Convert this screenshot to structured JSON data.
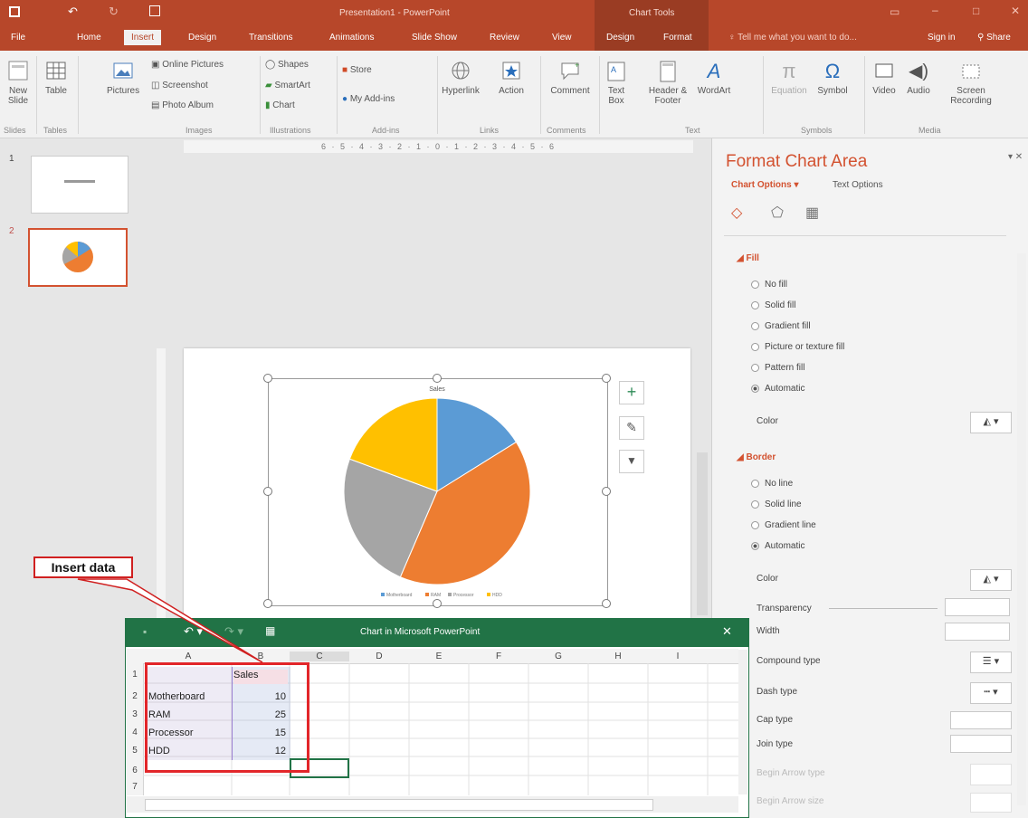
{
  "titlebar": {
    "doc_title": "Presentation1 - PowerPoint",
    "context_tab": "Chart Tools"
  },
  "tabs": [
    "File",
    "Home",
    "Insert",
    "Design",
    "Transitions",
    "Animations",
    "Slide Show",
    "Review",
    "View",
    "Design",
    "Format"
  ],
  "tell_me": "Tell me what you want to do...",
  "sign_in": "Sign in",
  "share": "Share",
  "ribbon": {
    "new_slide": "New Slide",
    "table": "Table",
    "pictures": "Pictures",
    "online_pictures": "Online Pictures",
    "screenshot": "Screenshot",
    "photo_album": "Photo Album",
    "shapes": "Shapes",
    "smartart": "SmartArt",
    "chart": "Chart",
    "store": "Store",
    "my_addins": "My Add-ins",
    "hyperlink": "Hyperlink",
    "action": "Action",
    "comment": "Comment",
    "text_box": "Text Box",
    "header_footer": "Header & Footer",
    "wordart": "WordArt",
    "equation": "Equation",
    "symbol": "Symbol",
    "video": "Video",
    "audio": "Audio",
    "screen_recording": "Screen Recording",
    "groups": [
      "Slides",
      "Tables",
      "Images",
      "Illustrations",
      "Add-ins",
      "Links",
      "Comments",
      "Text",
      "Symbols",
      "Media"
    ]
  },
  "slides": [
    "1",
    "2"
  ],
  "ruler_text": "6 · 5 · 4 · 3 · 2 · 1 · 0 · 1 · 2 · 3 · 4 · 5 · 6",
  "callout": "Insert data",
  "format_pane": {
    "title": "Format Chart Area",
    "chart_options": "Chart Options",
    "text_options": "Text Options",
    "fill_header": "Fill",
    "fill_options": [
      "No fill",
      "Solid fill",
      "Gradient fill",
      "Picture or texture fill",
      "Pattern fill",
      "Automatic"
    ],
    "color_label": "Color",
    "border_header": "Border",
    "border_options": [
      "No line",
      "Solid line",
      "Gradient line",
      "Automatic"
    ],
    "border_color": "Color",
    "transparency": "Transparency",
    "width": "Width",
    "compound_type": "Compound type",
    "dash_type": "Dash type",
    "cap_type": "Cap type",
    "join_type": "Join type",
    "begin_arrow_type": "Begin Arrow type",
    "begin_arrow_size": "Begin Arrow size"
  },
  "excel": {
    "title": "Chart in Microsoft PowerPoint",
    "columns": [
      "A",
      "B",
      "C",
      "D",
      "E",
      "F",
      "G",
      "H",
      "I"
    ],
    "rows": [
      "1",
      "2",
      "3",
      "4",
      "5",
      "6",
      "7"
    ],
    "header_b": "Sales",
    "data": [
      {
        "name": "Motherboard",
        "value": "10"
      },
      {
        "name": "RAM",
        "value": "25"
      },
      {
        "name": "Processor",
        "value": "15"
      },
      {
        "name": "HDD",
        "value": "12"
      }
    ]
  },
  "chart_data": {
    "type": "pie",
    "title": "Sales",
    "categories": [
      "Motherboard",
      "RAM",
      "Processor",
      "HDD"
    ],
    "values": [
      10,
      25,
      15,
      12
    ],
    "colors": [
      "#5b9bd5",
      "#ed7d31",
      "#a5a5a5",
      "#ffc000"
    ],
    "legend": "bottom"
  }
}
